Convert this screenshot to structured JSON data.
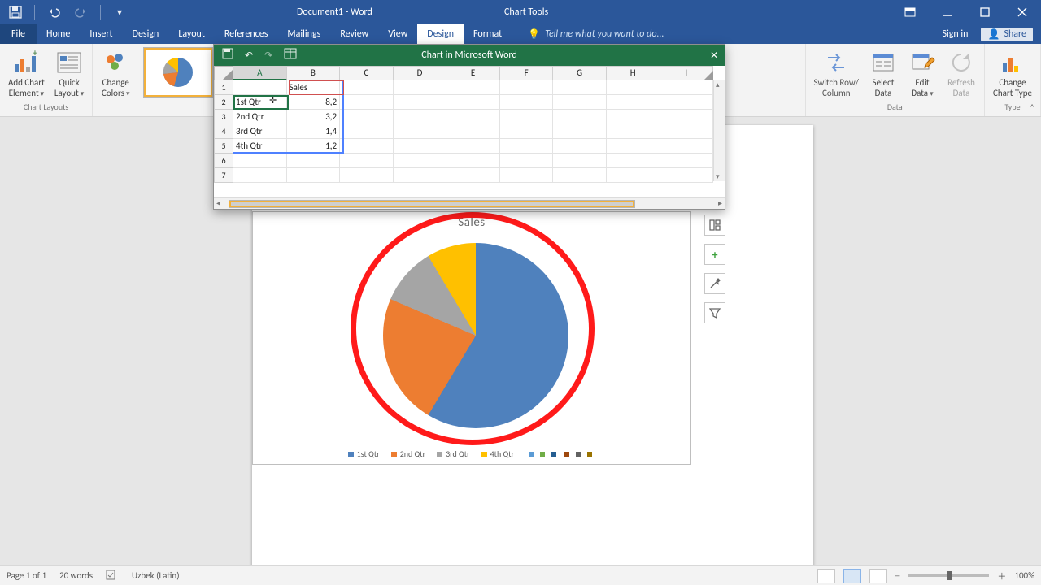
{
  "app": {
    "doc_title": "Document1 - Word",
    "chart_tools": "Chart Tools"
  },
  "tabs": {
    "file": "File",
    "home": "Home",
    "insert": "Insert",
    "design_doc": "Design",
    "layout": "Layout",
    "references": "References",
    "mailings": "Mailings",
    "review": "Review",
    "view": "View",
    "design": "Design",
    "format": "Format",
    "tell": "Tell me what you want to do...",
    "signin": "Sign in",
    "share": "Share"
  },
  "ribbon": {
    "add_element": "Add Chart\nElement",
    "quick_layout": "Quick\nLayout",
    "change_colors": "Change\nColors",
    "group_layouts": "Chart Layouts",
    "switch": "Switch Row/\nColumn",
    "select": "Select\nData",
    "edit": "Edit\nData",
    "refresh": "Refresh\nData",
    "group_data": "Data",
    "change_type": "Change\nChart Type",
    "group_type": "Type"
  },
  "excel": {
    "title": "Chart in Microsoft Word",
    "cols": [
      "A",
      "B",
      "C",
      "D",
      "E",
      "F",
      "G",
      "H",
      "I"
    ],
    "header": {
      "a": "",
      "b": "Sales"
    },
    "rows": [
      {
        "a": "1st Qtr",
        "b": "8,2"
      },
      {
        "a": "2nd Qtr",
        "b": "3,2"
      },
      {
        "a": "3rd Qtr",
        "b": "1,4"
      },
      {
        "a": "4th Qtr",
        "b": "1,2"
      }
    ]
  },
  "chart_data": {
    "type": "pie",
    "title": "Sales",
    "categories": [
      "1st Qtr",
      "2nd Qtr",
      "3rd Qtr",
      "4th Qtr"
    ],
    "values": [
      8.2,
      3.2,
      1.4,
      1.2
    ],
    "colors": [
      "#4f81bd",
      "#ed7d31",
      "#a5a5a5",
      "#ffc000"
    ],
    "legend_position": "bottom"
  },
  "status": {
    "page": "Page 1 of 1",
    "words": "20 words",
    "lang": "Uzbek (Latin)",
    "zoom": "100%"
  }
}
